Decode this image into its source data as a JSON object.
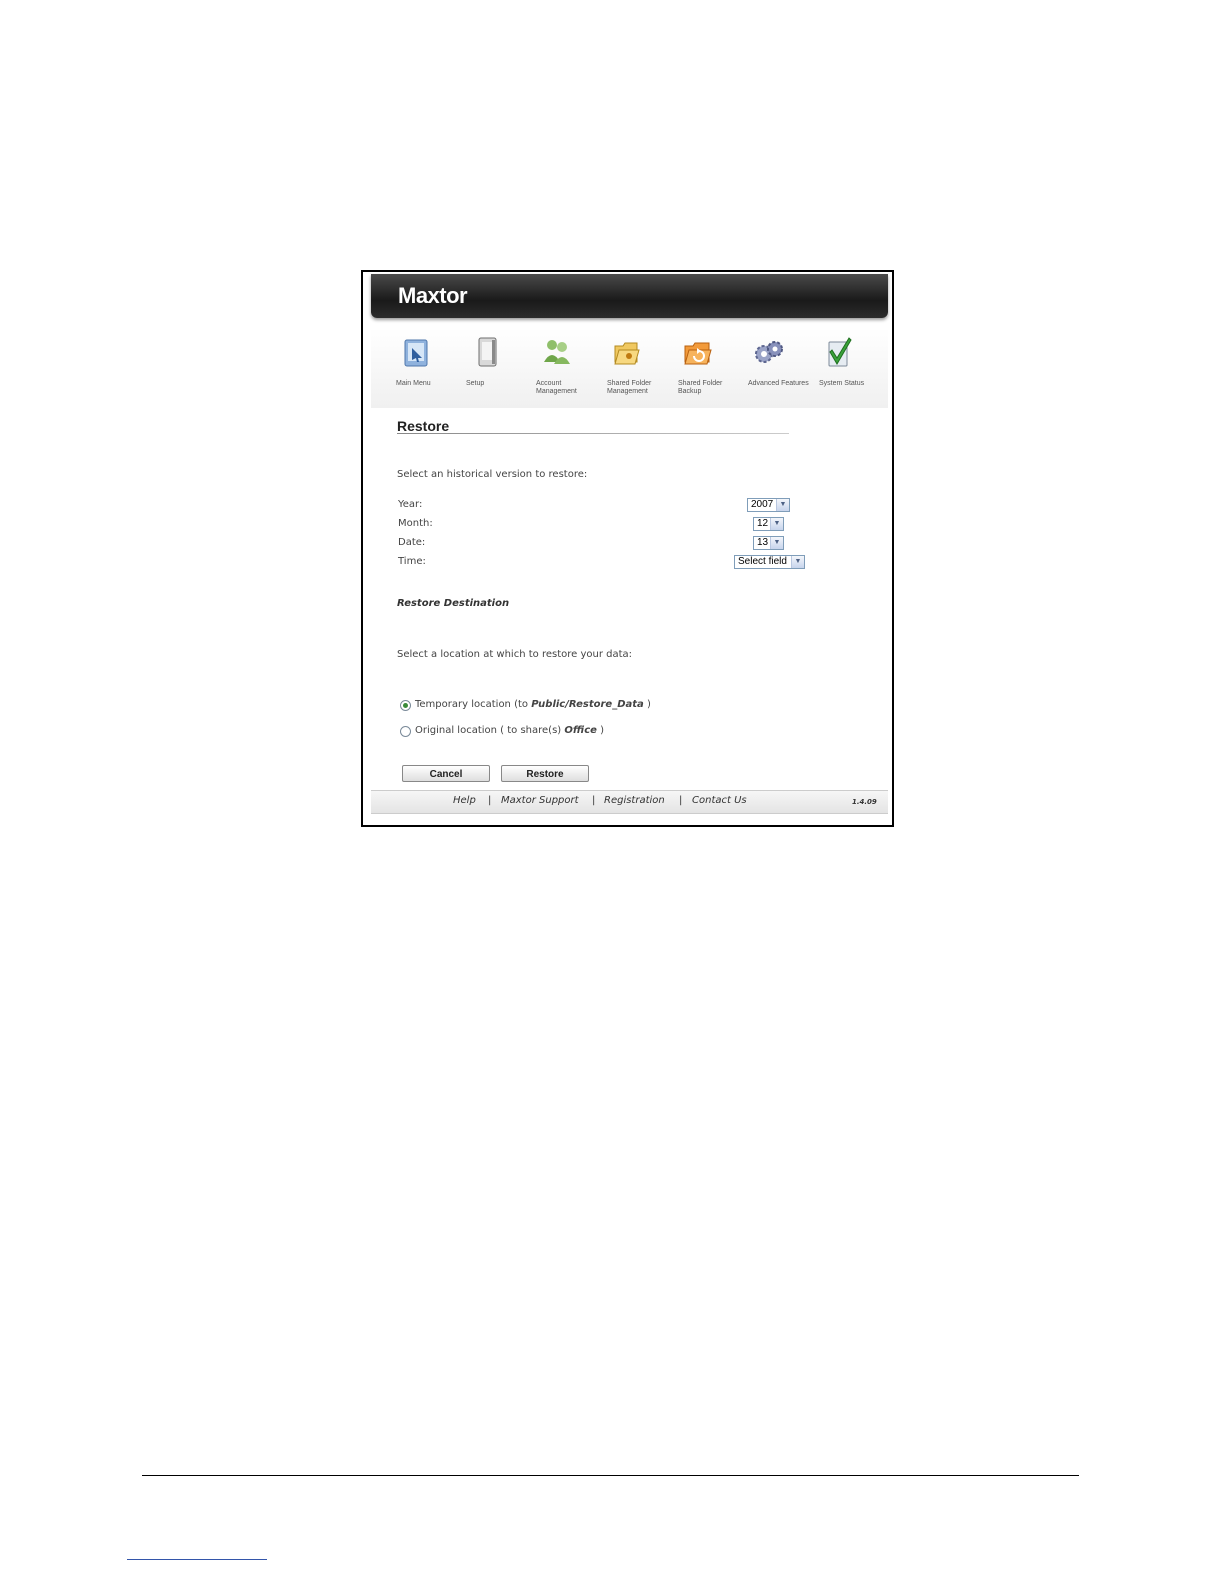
{
  "app": {
    "logo": "Maxtor",
    "version": "1.4.09"
  },
  "nav": {
    "items": [
      {
        "label": "Main Menu",
        "icon": "main-menu-icon"
      },
      {
        "label": "Setup",
        "icon": "setup-icon"
      },
      {
        "label": "Account Management",
        "icon": "account-management-icon"
      },
      {
        "label": "Shared Folder Management",
        "icon": "shared-folder-management-icon"
      },
      {
        "label": "Shared Folder Backup",
        "icon": "shared-folder-backup-icon"
      },
      {
        "label": "Advanced Features",
        "icon": "advanced-features-icon"
      },
      {
        "label": "System Status",
        "icon": "system-status-icon"
      }
    ]
  },
  "page": {
    "title": "Restore",
    "instruction": "Select an historical version to restore:"
  },
  "form": {
    "year": {
      "label": "Year:",
      "value": "2007"
    },
    "month": {
      "label": "Month:",
      "value": "12"
    },
    "date": {
      "label": "Date:",
      "value": "13"
    },
    "time": {
      "label": "Time:",
      "value": "Select field"
    }
  },
  "destination": {
    "heading": "Restore Destination",
    "instruction": "Select a location at which to restore your data:",
    "options": [
      {
        "prefix": "Temporary location (to ",
        "target": "Public/Restore_Data",
        "suffix": " )",
        "checked": true
      },
      {
        "prefix": "Original location ( to share(s) ",
        "target": "Office",
        "suffix": " )",
        "checked": false
      }
    ]
  },
  "buttons": {
    "cancel": "Cancel",
    "restore": "Restore"
  },
  "footer": {
    "links": [
      "Help",
      "Maxtor Support",
      "Registration",
      "Contact Us"
    ],
    "separator": "|"
  },
  "colors": {
    "header_dark": "#1a1a1a",
    "radio_selected": "#3a8a3a"
  }
}
